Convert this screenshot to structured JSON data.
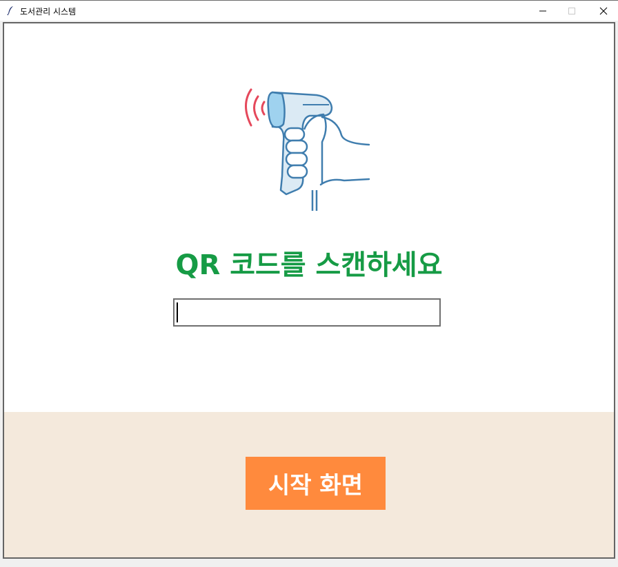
{
  "window": {
    "title": "도서관리 시스템",
    "icons": {
      "app": "feather-icon",
      "minimize": "minimize-icon",
      "maximize": "maximize-icon",
      "close": "close-icon"
    }
  },
  "scan": {
    "illustration": "barcode-scanner-icon",
    "heading": "QR 코드를 스캔하세요",
    "input_value": "",
    "heading_color": "#169b45"
  },
  "footer": {
    "start_button_label": "시작 화면",
    "button_color": "#ff8a3d",
    "panel_color": "#f4e9dc"
  }
}
